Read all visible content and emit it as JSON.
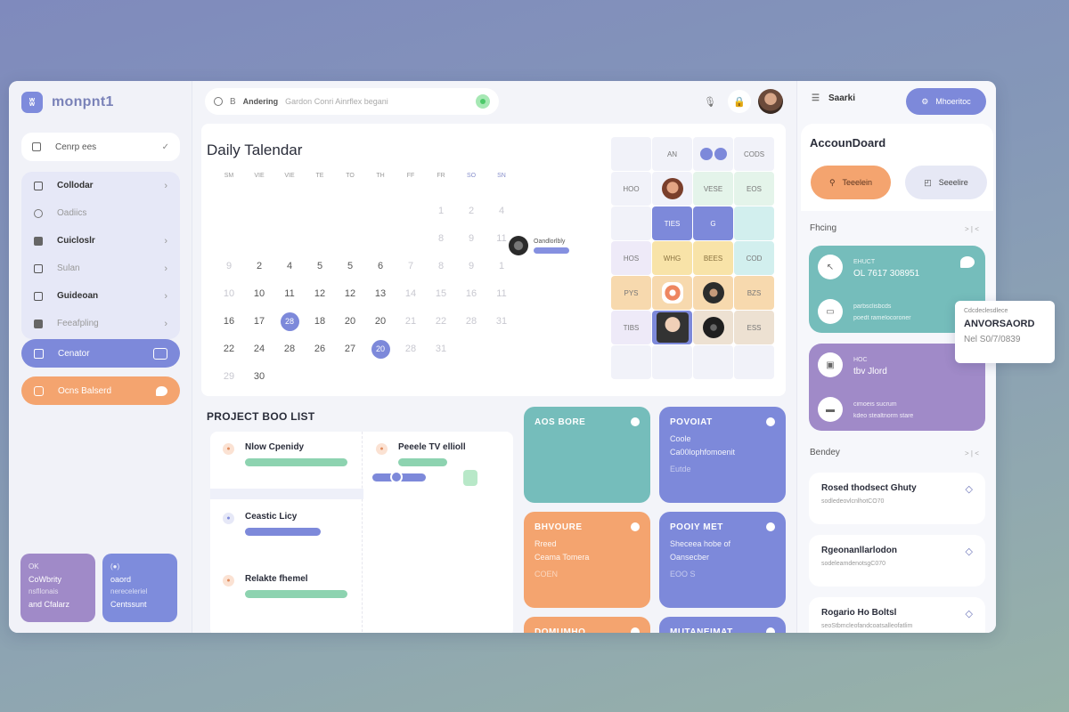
{
  "app": {
    "name": "monpnt1"
  },
  "sidebar": {
    "top_item": {
      "label": "Cenrp ees",
      "check": "✓"
    },
    "items": [
      {
        "label": "Collodar",
        "icon": "square-icon",
        "chevron": "›",
        "style": "bold"
      },
      {
        "label": "Oadiics",
        "icon": "circle-icon",
        "chevron": "",
        "style": "muted"
      },
      {
        "label": "Cuicloslr",
        "icon": "list-icon",
        "chevron": "›",
        "style": "bold"
      },
      {
        "label": "Sulan",
        "icon": "pi-icon",
        "chevron": "›",
        "style": "muted"
      },
      {
        "label": "Guideoan",
        "icon": "book-icon",
        "chevron": "›",
        "style": "bold"
      },
      {
        "label": "Feeafpling",
        "icon": "grid-icon",
        "chevron": "›",
        "style": "muted"
      }
    ],
    "active_item": {
      "label": "Cenator"
    },
    "orange_item": {
      "label": "Ocns Balserd"
    },
    "mini_cards": [
      {
        "tag": "OK",
        "line1": "CoWbrity",
        "line2": "nsfllonais",
        "line3": "and Cfalarz"
      },
      {
        "tag": "(●)",
        "line1": "oaord",
        "line2": "nereceleriel",
        "line3": "Centssunt"
      }
    ]
  },
  "topbar": {
    "search_label": "Andering",
    "search_placeholder": "Gardon  Conri Ainrflex begani",
    "icons": [
      "microphone-icon",
      "lock-icon"
    ]
  },
  "calendar": {
    "title": "Daily Talendar",
    "weekdays": [
      "SM",
      "VIE",
      "VIE",
      "TE",
      "TO",
      "TH",
      "FF",
      "FR",
      "SO",
      "SN"
    ],
    "rows": [
      [
        {
          "d": ""
        },
        {
          "d": ""
        },
        {
          "d": ""
        },
        {
          "d": ""
        },
        {
          "d": ""
        },
        {
          "d": ""
        },
        {
          "d": ""
        },
        {
          "d": "1",
          "f": 1
        },
        {
          "d": "2",
          "f": 1
        },
        {
          "d": "4",
          "f": 1
        }
      ],
      [
        {
          "d": ""
        },
        {
          "d": ""
        },
        {
          "d": ""
        },
        {
          "d": ""
        },
        {
          "d": ""
        },
        {
          "d": ""
        },
        {
          "d": ""
        },
        {
          "d": "8",
          "f": 1
        },
        {
          "d": "9",
          "f": 1
        },
        {
          "d": "11",
          "f": 1
        }
      ],
      [
        {
          "d": "9",
          "f": 1
        },
        {
          "d": "2"
        },
        {
          "d": "4"
        },
        {
          "d": "5"
        },
        {
          "d": "5"
        },
        {
          "d": "6"
        },
        {
          "d": "7",
          "f": 1
        },
        {
          "d": "8",
          "f": 1
        },
        {
          "d": "9",
          "f": 1
        },
        {
          "d": "1",
          "f": 1
        }
      ],
      [
        {
          "d": "10",
          "f": 1
        },
        {
          "d": "10"
        },
        {
          "d": "11"
        },
        {
          "d": "12"
        },
        {
          "d": "12"
        },
        {
          "d": "13"
        },
        {
          "d": "14",
          "f": 1
        },
        {
          "d": "15",
          "f": 1
        },
        {
          "d": "16",
          "f": 1
        },
        {
          "d": "11",
          "f": 1
        }
      ],
      [
        {
          "d": "16"
        },
        {
          "d": "17"
        },
        {
          "d": "28",
          "s": 1
        },
        {
          "d": "18"
        },
        {
          "d": "20"
        },
        {
          "d": "20"
        },
        {
          "d": "21",
          "f": 1
        },
        {
          "d": "22",
          "f": 1
        },
        {
          "d": "28",
          "f": 1
        },
        {
          "d": "31",
          "f": 1
        }
      ],
      [
        {
          "d": "22"
        },
        {
          "d": "24"
        },
        {
          "d": "28"
        },
        {
          "d": "26"
        },
        {
          "d": "27"
        },
        {
          "d": "20",
          "s": 1
        },
        {
          "d": "28",
          "f": 1
        },
        {
          "d": "31",
          "f": 1
        },
        {
          "d": ""
        },
        {
          "d": ""
        }
      ],
      [
        {
          "d": "29",
          "f": 1
        },
        {
          "d": "30"
        },
        {
          "d": ""
        },
        {
          "d": ""
        },
        {
          "d": ""
        },
        {
          "d": ""
        },
        {
          "d": ""
        },
        {
          "d": ""
        },
        {
          "d": ""
        },
        {
          "d": ""
        }
      ]
    ],
    "event": {
      "name": "Oandlorlbly"
    }
  },
  "schedule": {
    "cells": [
      {
        "t": "",
        "c": ""
      },
      {
        "t": "AN",
        "c": ""
      },
      {
        "t": "pills",
        "c": ""
      },
      {
        "t": "CODS",
        "c": ""
      },
      {
        "t": "HOO",
        "c": ""
      },
      {
        "t": "face1",
        "c": ""
      },
      {
        "t": "VESE",
        "c": "mint"
      },
      {
        "t": "EOS",
        "c": "mint"
      },
      {
        "t": "",
        "c": ""
      },
      {
        "t": "TIES",
        "c": "blue"
      },
      {
        "t": "G",
        "c": "blue"
      },
      {
        "t": "",
        "c": "teal"
      },
      {
        "t": "HOS",
        "c": "lav"
      },
      {
        "t": "WHG",
        "c": "yellow"
      },
      {
        "t": "BEES",
        "c": "yellow"
      },
      {
        "t": "COD",
        "c": "teal"
      },
      {
        "t": "PYS",
        "c": "peach"
      },
      {
        "t": "face2",
        "c": "peach"
      },
      {
        "t": "face3",
        "c": "peach"
      },
      {
        "t": "BZS",
        "c": "peach"
      },
      {
        "t": "TIBS",
        "c": "lav"
      },
      {
        "t": "face4",
        "c": "blue"
      },
      {
        "t": "face5",
        "c": "beige"
      },
      {
        "t": "ESS",
        "c": "beige"
      },
      {
        "t": "",
        "c": ""
      },
      {
        "t": "",
        "c": ""
      },
      {
        "t": "",
        "c": ""
      },
      {
        "t": "",
        "c": ""
      }
    ]
  },
  "project": {
    "title": "PROJECT BOO LIST",
    "tasks": [
      {
        "name": "Nlow Cpenidy",
        "progress": 1.0,
        "color": "green"
      },
      {
        "name": "Peeele TV ellioll",
        "progress": 0.48,
        "color": "green"
      },
      {
        "name": "Ceastic Licy",
        "progress": 0.74,
        "color": "blue"
      },
      {
        "name": "Relakte fhemel",
        "progress": 1.0,
        "color": "green"
      }
    ]
  },
  "kanban": [
    {
      "title": "AOS BORE",
      "l1": "",
      "l2": "",
      "l3": "",
      "color": "teal"
    },
    {
      "title": "POVOIAT",
      "l1": "Coole",
      "l2": "Ca00lophfomoenit",
      "l3": "Eutde",
      "color": "indigo"
    },
    {
      "title": "BHVOURE",
      "l1": "Rreed",
      "l2": "Ceama Tomera",
      "l3": "COEN",
      "color": "orange"
    },
    {
      "title": "POOIY MET",
      "l1": "Sheceea hobe of",
      "l2": "Oansecber",
      "l3": "EOO S",
      "color": "indigo"
    },
    {
      "title": "DOMUMHO",
      "l1": "",
      "l2": "",
      "l3": "",
      "color": "orange"
    },
    {
      "title": "MUTANEIMAT",
      "l1": "",
      "l2": "",
      "l3": "",
      "color": "indigo"
    }
  ],
  "right": {
    "top_label": "Saarki",
    "top_button": "Mhoeritoc",
    "title": "AccounDoard",
    "pill_orange": "Teeelein",
    "pill_gray": "Seeelire",
    "section1": "Fhcing",
    "section1_nav": "> | <",
    "feature_cards": [
      {
        "small": "EHUCT",
        "big": "OL 7617 308951",
        "small2": "parbsclisbcds",
        "big2": "poedt ramelocoroner"
      },
      {
        "small": "HOC",
        "big": "tbv Jlord",
        "small2": "cimoeis sucrum",
        "big2": "kdeo stealtnorm stare"
      }
    ],
    "tooltip": {
      "label": "Cdcdeclesdlece",
      "title": "ANVORSAORD",
      "value": "Nel S0/7/0839"
    },
    "section2": "Bendey",
    "section2_nav": "> | <",
    "list": [
      {
        "title": "Rosed thodsect Ghuty",
        "sub": "sodledeovlcnlhotCO70"
      },
      {
        "title": "Rgeonanllarlodon",
        "sub": "sodeleamdenotsgC070"
      },
      {
        "title": "Rogario Ho Boltsl",
        "sub": "seoStbmcleofandcoatsalleofatlim"
      }
    ]
  }
}
